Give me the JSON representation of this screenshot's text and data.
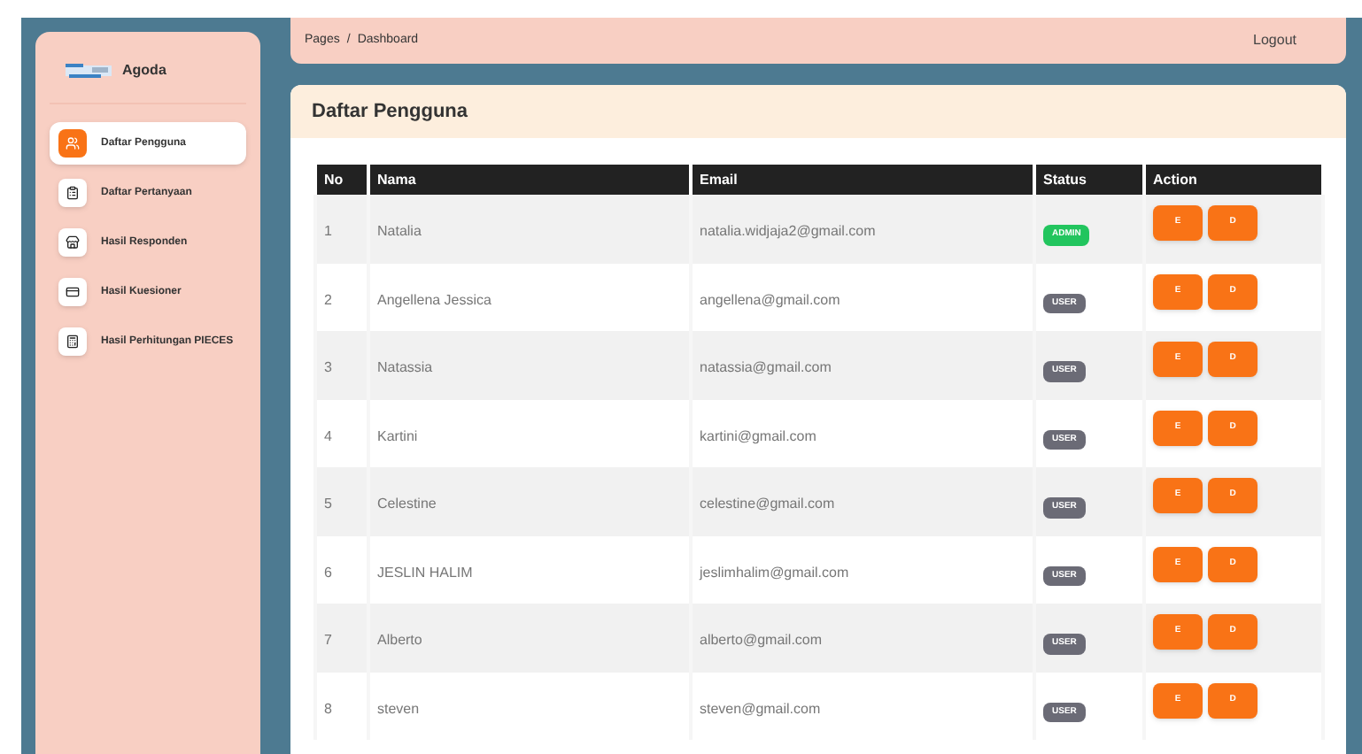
{
  "brand": {
    "name": "Agoda"
  },
  "sidebar": {
    "items": [
      {
        "label": "Daftar Pengguna",
        "selected": true
      },
      {
        "label": "Daftar Pertanyaan",
        "selected": false
      },
      {
        "label": "Hasil Responden",
        "selected": false
      },
      {
        "label": "Hasil Kuesioner",
        "selected": false
      },
      {
        "label": "Hasil Perhitungan PIECES",
        "selected": false
      }
    ]
  },
  "topbar": {
    "breadcrumb": [
      "Pages",
      "Dashboard"
    ],
    "separator": "/",
    "logout": "Logout"
  },
  "card": {
    "title": "Daftar Pengguna"
  },
  "table": {
    "columns": [
      "No",
      "Nama",
      "Email",
      "Status",
      "Action"
    ],
    "rows": [
      {
        "no": "1",
        "name": "Natalia",
        "email": "natalia.widjaja2@gmail.com",
        "status": "ADMIN",
        "color": "#22c55e",
        "edit": "E",
        "delete": "D"
      },
      {
        "no": "2",
        "name": "Angellena Jessica",
        "email": "angellena@gmail.com",
        "status": "USER",
        "color": "#6b6b76",
        "edit": "E",
        "delete": "D"
      },
      {
        "no": "3",
        "name": "Natassia",
        "email": "natassia@gmail.com",
        "status": "USER",
        "color": "#6b6b76",
        "edit": "E",
        "delete": "D"
      },
      {
        "no": "4",
        "name": "Kartini",
        "email": "kartini@gmail.com",
        "status": "USER",
        "color": "#6b6b76",
        "edit": "E",
        "delete": "D"
      },
      {
        "no": "5",
        "name": "Celestine",
        "email": "celestine@gmail.com",
        "status": "USER",
        "color": "#6b6b76",
        "edit": "E",
        "delete": "D"
      },
      {
        "no": "6",
        "name": "JESLIN HALIM",
        "email": "jeslimhalim@gmail.com",
        "status": "USER",
        "color": "#6b6b76",
        "edit": "E",
        "delete": "D"
      },
      {
        "no": "7",
        "name": "Alberto",
        "email": "alberto@gmail.com",
        "status": "USER",
        "color": "#6b6b76",
        "edit": "E",
        "delete": "D"
      },
      {
        "no": "8",
        "name": "steven",
        "email": "steven@gmail.com",
        "status": "USER",
        "color": "#6b6b76",
        "edit": "E",
        "delete": "D"
      }
    ]
  }
}
